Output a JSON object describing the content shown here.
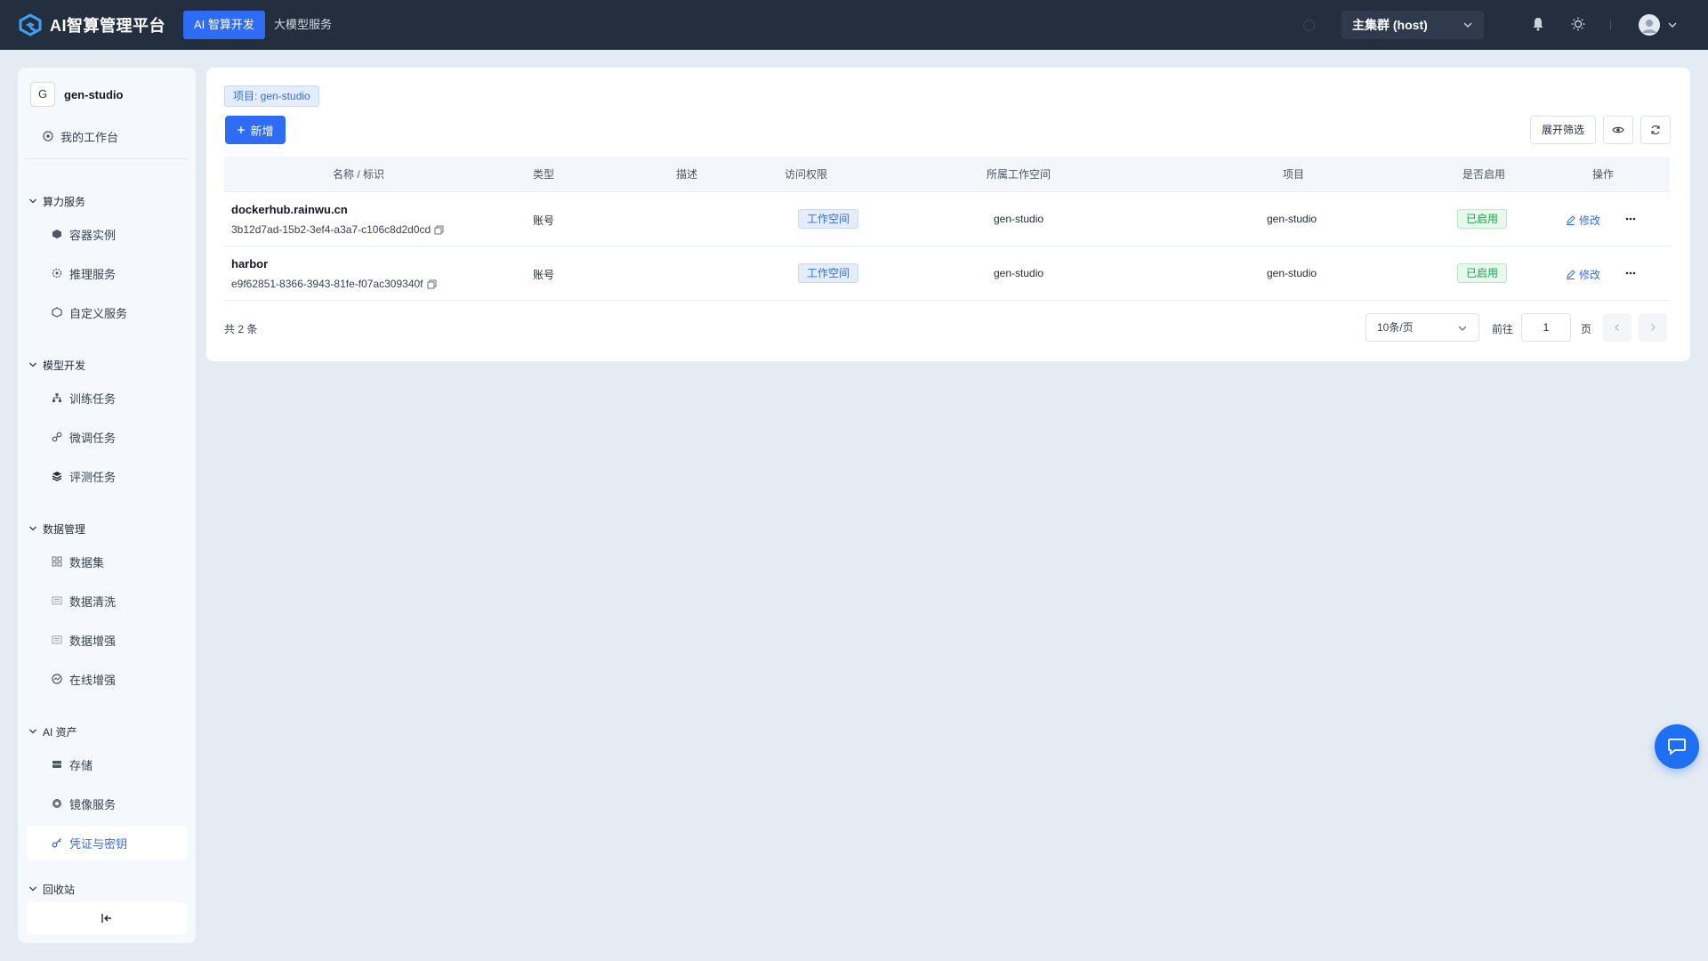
{
  "app": {
    "title": "AI智算管理平台",
    "nav_tabs": [
      {
        "label": "AI 智算开发",
        "active": true
      },
      {
        "label": "大模型服务",
        "active": false
      }
    ],
    "cluster": "主集群 (host)",
    "accent_color": "#2f6cf6",
    "topbar_color": "#232e3f"
  },
  "sidebar": {
    "project_badge": "G",
    "project_name": "gen-studio",
    "workbench": "我的工作台",
    "groups": [
      {
        "label": "算力服务",
        "items": [
          "容器实例",
          "推理服务",
          "自定义服务"
        ]
      },
      {
        "label": "模型开发",
        "items": [
          "训练任务",
          "微调任务",
          "评测任务"
        ]
      },
      {
        "label": "数据管理",
        "items": [
          "数据集",
          "数据清洗",
          "数据增强",
          "在线增强"
        ]
      },
      {
        "label": "AI 资产",
        "items": [
          "存储",
          "镜像服务",
          "凭证与密钥"
        ]
      },
      {
        "label": "回收站",
        "items": []
      }
    ],
    "active_item": "凭证与密钥"
  },
  "main": {
    "project_tag": "项目: gen-studio",
    "add_button": "新增",
    "filter_button": "展开筛选",
    "columns": [
      "名称 / 标识",
      "类型",
      "描述",
      "访问权限",
      "所属工作空间",
      "项目",
      "是否启用",
      "操作"
    ],
    "rows": [
      {
        "name": "dockerhub.rainwu.cn",
        "id": "3b12d7ad-15b2-3ef4-a3a7-c106c8d2d0cd",
        "type": "账号",
        "description": "",
        "access": "工作空间",
        "workspace": "gen-studio",
        "project": "gen-studio",
        "enabled": "已启用",
        "action": "修改"
      },
      {
        "name": "harbor",
        "id": "e9f62851-8366-3943-81fe-f07ac309340f",
        "type": "账号",
        "description": "",
        "access": "工作空间",
        "workspace": "gen-studio",
        "project": "gen-studio",
        "enabled": "已启用",
        "action": "修改"
      }
    ],
    "total": "共 2 条",
    "page_size": "10条/页",
    "goto_label": "前往",
    "page_number": "1",
    "page_label": "页"
  }
}
